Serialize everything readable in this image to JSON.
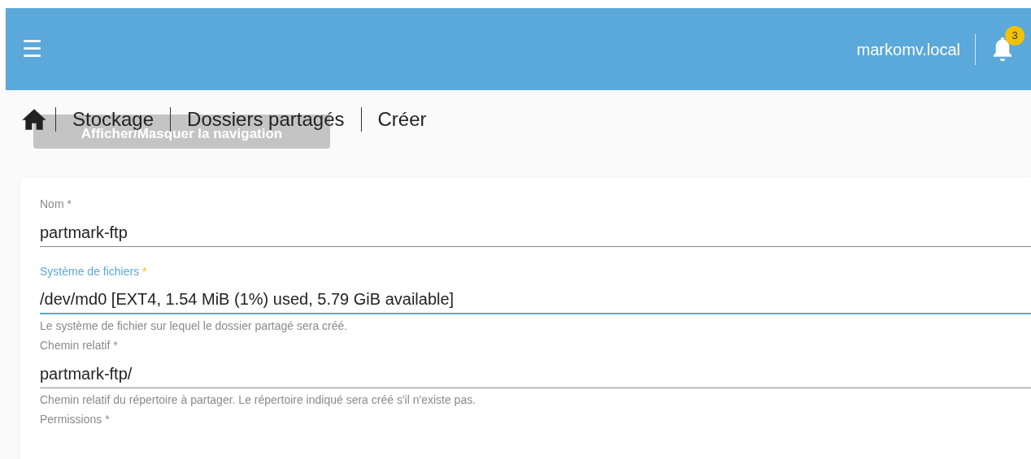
{
  "header": {
    "menu_icon": "☰",
    "hostname": "markomv.local",
    "notifications": {
      "count": "3"
    }
  },
  "breadcrumb": {
    "items": [
      {
        "label": "Stockage"
      },
      {
        "label": "Dossiers partagés"
      },
      {
        "label": "Créer"
      }
    ]
  },
  "tooltip": "Afficher/Masquer la navigation",
  "form": {
    "fields": [
      {
        "label": "Nom",
        "required_mark": "*",
        "value": "partmark-ftp",
        "focused": false
      },
      {
        "label": "Système de fichiers",
        "required_mark": "*",
        "value": "/dev/md0 [EXT4, 1.54 MiB (1%) used, 5.79 GiB available]",
        "focused": true,
        "hint": "Le système de fichier sur lequel le dossier partagé sera créé."
      },
      {
        "label": "Chemin relatif",
        "required_mark": "*",
        "value": "partmark-ftp/",
        "focused": false,
        "hint": "Chemin relatif du répertoire à partager. Le répertoire indiqué sera créé s'il n'existe pas."
      },
      {
        "label": "Permissions",
        "required_mark": "*",
        "focused": false
      }
    ]
  }
}
